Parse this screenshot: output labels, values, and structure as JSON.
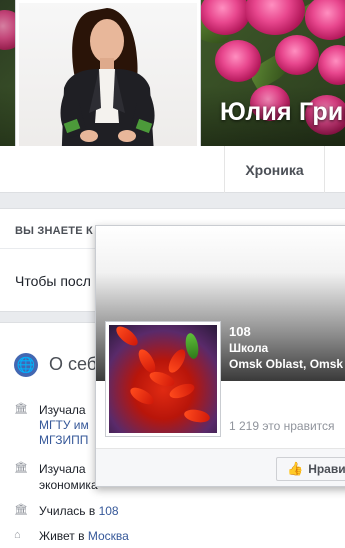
{
  "profile": {
    "cover_name": "Юлия Григ"
  },
  "tabs": {
    "chronicle": "Хроника"
  },
  "know_card": {
    "heading": "ВЫ ЗНАЕТЕ К",
    "text": "Чтобы посл"
  },
  "about": {
    "title": "О себе",
    "rows": [
      {
        "icon": "graduation-cap-icon",
        "prefix": "Изучала",
        "line2": "МГТУ им",
        "line3": "МГЗИПП"
      },
      {
        "icon": "graduation-cap-icon",
        "prefix": "Изучала",
        "line2": "экономика"
      },
      {
        "icon": "graduation-cap-icon",
        "prefix": "Училась в",
        "link": "108"
      },
      {
        "icon": "home-icon",
        "prefix": "Живет в",
        "link": "Москва"
      }
    ]
  },
  "hovercard": {
    "name": "108",
    "category": "Школа",
    "location": "Omsk Oblast, Omsk",
    "likes": "1 219 это нравится",
    "like_button": "Нрави"
  },
  "colors": {
    "link": "#365899",
    "facebook_blue": "#4267b2",
    "page_bg": "#e9ebee"
  }
}
